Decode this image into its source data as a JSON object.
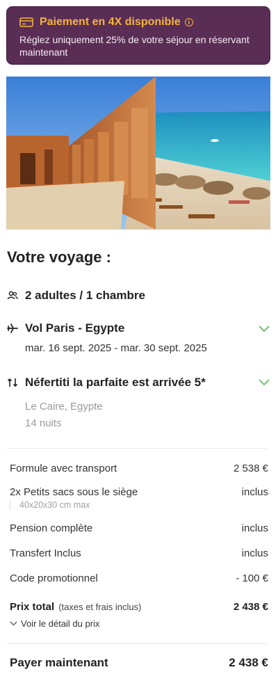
{
  "banner": {
    "title": "Paiement en 4X disponible",
    "text": "Réglez uniquement 25% de votre séjour en réservant maintenant",
    "info_icon": "i"
  },
  "trip": {
    "section_title": "Votre voyage :",
    "travellers": "2 adultes / 1 chambre",
    "flight": {
      "label": "Vol Paris - Egypte",
      "dates": "mar. 16 sept. 2025 - mar. 30 sept. 2025"
    },
    "hotel": {
      "label": "Néfertiti la parfaite est arrivée 5*",
      "location": "Le Caire, Egypte",
      "nights": "14 nuits"
    }
  },
  "pricing": {
    "lines": [
      {
        "label": "Formule avec transport",
        "value": "2 538 €"
      },
      {
        "label": "2x Petits sacs sous le siège",
        "value": "inclus",
        "note": "40x20x30 cm max"
      },
      {
        "label": "Pension complète",
        "value": "inclus"
      },
      {
        "label": "Transfert Inclus",
        "value": "inclus"
      },
      {
        "label": "Code promotionnel",
        "value": "- 100 €"
      }
    ],
    "total_label": "Prix total",
    "total_note": "(taxes et frais inclus)",
    "total_value": "2 438 €",
    "detail_link": "Voir le détail du prix",
    "pay_now_label": "Payer maintenant",
    "pay_now_value": "2 438 €"
  },
  "colors": {
    "banner_bg": "#5a2d55",
    "banner_accent": "#f3b43c",
    "chevron": "#5cb85c"
  }
}
